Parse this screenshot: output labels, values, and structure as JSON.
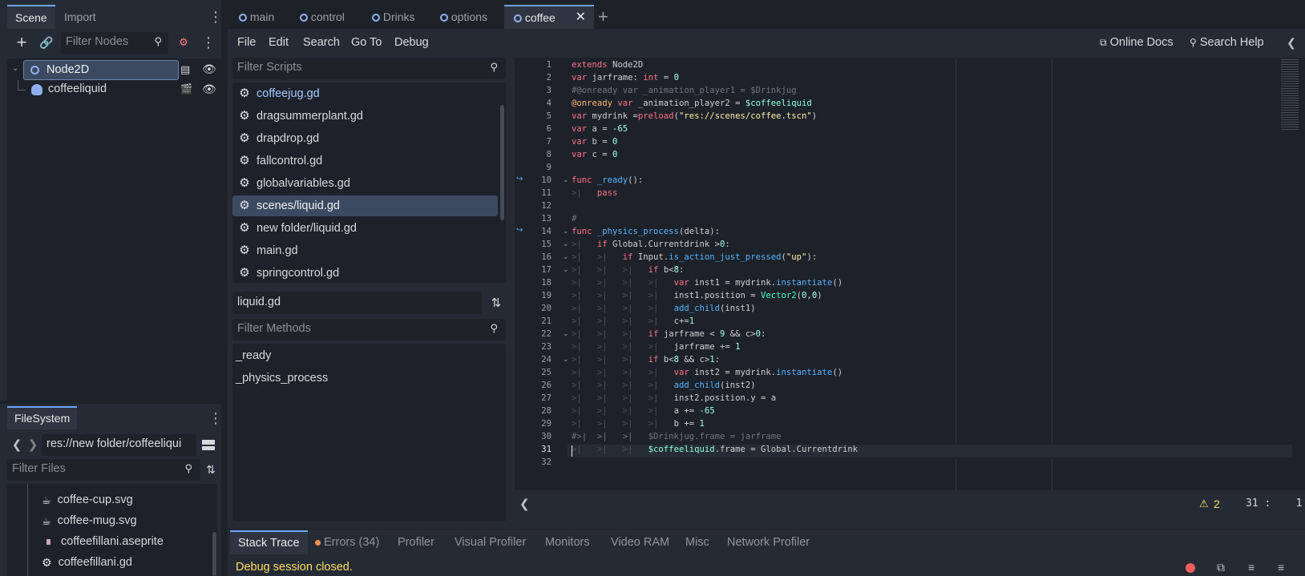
{
  "scene_dock": {
    "tabs": [
      "Scene",
      "Import"
    ],
    "filter_placeholder": "Filter Nodes",
    "tree": [
      {
        "label": "Node2D",
        "icon": "node2d-icon"
      },
      {
        "label": "coffeeliquid",
        "icon": "animated-sprite-icon"
      }
    ]
  },
  "filesystem": {
    "tab": "FileSystem",
    "path": "res://new folder/coffeeliqui",
    "filter_placeholder": "Filter Files",
    "items": [
      {
        "label": "coffee-cup.svg",
        "icon": "cup-icon"
      },
      {
        "label": "coffee-mug.svg",
        "icon": "mug-icon"
      },
      {
        "label": "coffeefillani.aseprite",
        "icon": "file-icon"
      },
      {
        "label": "coffeefillani.gd",
        "icon": "gear-icon"
      }
    ]
  },
  "main_tabs": [
    {
      "label": "main",
      "active": false
    },
    {
      "label": "control",
      "active": false
    },
    {
      "label": "Drinks",
      "active": false
    },
    {
      "label": "options",
      "active": false
    },
    {
      "label": "coffee",
      "active": true
    }
  ],
  "menu": {
    "items": [
      "File",
      "Edit",
      "Search",
      "Go To",
      "Debug"
    ],
    "online_docs": "Online Docs",
    "search_help": "Search Help"
  },
  "scripts": {
    "filter_placeholder": "Filter Scripts",
    "items": [
      {
        "label": "coffeejug.gd",
        "state": "highlight"
      },
      {
        "label": "dragsummerplant.gd",
        "state": "normal"
      },
      {
        "label": "drapdrop.gd",
        "state": "normal"
      },
      {
        "label": "fallcontrol.gd",
        "state": "normal"
      },
      {
        "label": "globalvariables.gd",
        "state": "normal"
      },
      {
        "label": "scenes/liquid.gd",
        "state": "selected"
      },
      {
        "label": "new folder/liquid.gd",
        "state": "normal"
      },
      {
        "label": "main.gd",
        "state": "normal"
      },
      {
        "label": "springcontrol.gd",
        "state": "normal"
      }
    ],
    "current_file": "liquid.gd",
    "methods_placeholder": "Filter Methods",
    "methods": [
      "_ready",
      "_physics_process"
    ]
  },
  "code": {
    "lines": [
      [
        [
          "kw",
          "extends "
        ],
        [
          "plain",
          "Node2D"
        ]
      ],
      [
        [
          "kw",
          "var "
        ],
        [
          "plain",
          "jarframe: "
        ],
        [
          "kw",
          "int"
        ],
        [
          "plain",
          " = "
        ],
        [
          "num",
          "0"
        ]
      ],
      [
        [
          "cmt",
          "#@onready var _animation_player1 = $Drinkjug"
        ]
      ],
      [
        [
          "ann",
          "@onready "
        ],
        [
          "kw",
          "var "
        ],
        [
          "plain",
          "_animation_player2 = "
        ],
        [
          "node",
          "$coffeeliquid"
        ]
      ],
      [
        [
          "kw",
          "var "
        ],
        [
          "plain",
          "mydrink ="
        ],
        [
          "kw",
          "preload"
        ],
        [
          "plain",
          "("
        ],
        [
          "str",
          "\"res://scenes/coffee.tscn\""
        ],
        [
          "plain",
          ")"
        ]
      ],
      [
        [
          "kw",
          "var "
        ],
        [
          "plain",
          "a = "
        ],
        [
          "num",
          "-65"
        ]
      ],
      [
        [
          "kw",
          "var "
        ],
        [
          "plain",
          "b = "
        ],
        [
          "num",
          "0"
        ]
      ],
      [
        [
          "kw",
          "var "
        ],
        [
          "plain",
          "c = "
        ],
        [
          "num",
          "0"
        ]
      ],
      [],
      [
        [
          "kw",
          "func "
        ],
        [
          "fn",
          "_ready"
        ],
        [
          "plain",
          "():"
        ]
      ],
      [
        [
          "guide",
          ">|   "
        ],
        [
          "kw",
          "pass"
        ]
      ],
      [],
      [
        [
          "cmt",
          "#"
        ]
      ],
      [
        [
          "kw",
          "func "
        ],
        [
          "fn",
          "_physics_process"
        ],
        [
          "plain",
          "(delta):"
        ]
      ],
      [
        [
          "guide",
          ">|   "
        ],
        [
          "kw",
          "if "
        ],
        [
          "plain",
          "Global.Currentdrink >"
        ],
        [
          "num",
          "0"
        ],
        [
          "plain",
          ":"
        ]
      ],
      [
        [
          "guide",
          ">|   >|   "
        ],
        [
          "kw",
          "if "
        ],
        [
          "plain",
          "Input."
        ],
        [
          "fn",
          "is_action_just_pressed"
        ],
        [
          "plain",
          "("
        ],
        [
          "str",
          "\"up\""
        ],
        [
          "plain",
          "):"
        ]
      ],
      [
        [
          "guide",
          ">|   >|   >|   "
        ],
        [
          "kw",
          "if "
        ],
        [
          "plain",
          "b<"
        ],
        [
          "num",
          "8"
        ],
        [
          "plain",
          ":"
        ]
      ],
      [
        [
          "guide",
          ">|   >|   >|   >|   "
        ],
        [
          "kw",
          "var "
        ],
        [
          "plain",
          "inst1 = mydrink."
        ],
        [
          "fn",
          "instantiate"
        ],
        [
          "plain",
          "()"
        ]
      ],
      [
        [
          "guide",
          ">|   >|   >|   >|   "
        ],
        [
          "plain",
          "inst1.position = "
        ],
        [
          "ty",
          "Vector2"
        ],
        [
          "plain",
          "("
        ],
        [
          "num",
          "0"
        ],
        [
          "plain",
          ","
        ],
        [
          "num",
          "0"
        ],
        [
          "plain",
          ")"
        ]
      ],
      [
        [
          "guide",
          ">|   >|   >|   >|   "
        ],
        [
          "fn",
          "add_child"
        ],
        [
          "plain",
          "(inst1)"
        ]
      ],
      [
        [
          "guide",
          ">|   >|   >|   >|   "
        ],
        [
          "plain",
          "c+="
        ],
        [
          "num",
          "1"
        ]
      ],
      [
        [
          "guide",
          ">|   >|   >|   "
        ],
        [
          "kw",
          "if "
        ],
        [
          "plain",
          "jarframe < "
        ],
        [
          "num",
          "9"
        ],
        [
          "plain",
          " && c>"
        ],
        [
          "num",
          "0"
        ],
        [
          "plain",
          ":"
        ]
      ],
      [
        [
          "guide",
          ">|   >|   >|   >|   "
        ],
        [
          "plain",
          "jarframe += "
        ],
        [
          "num",
          "1"
        ]
      ],
      [
        [
          "guide",
          ">|   >|   >|   "
        ],
        [
          "kw",
          "if "
        ],
        [
          "plain",
          "b<"
        ],
        [
          "num",
          "8"
        ],
        [
          "plain",
          " && c>"
        ],
        [
          "num",
          "1"
        ],
        [
          "plain",
          ":"
        ]
      ],
      [
        [
          "guide",
          ">|   >|   >|   >|   "
        ],
        [
          "kw",
          "var "
        ],
        [
          "plain",
          "inst2 = mydrink."
        ],
        [
          "fn",
          "instantiate"
        ],
        [
          "plain",
          "()"
        ]
      ],
      [
        [
          "guide",
          ">|   >|   >|   >|   "
        ],
        [
          "fn",
          "add_child"
        ],
        [
          "plain",
          "(inst2)"
        ]
      ],
      [
        [
          "guide",
          ">|   >|   >|   >|   "
        ],
        [
          "plain",
          "inst2.position.y = a"
        ]
      ],
      [
        [
          "guide",
          ">|   >|   >|   >|   "
        ],
        [
          "plain",
          "a += "
        ],
        [
          "num",
          "-65"
        ]
      ],
      [
        [
          "guide",
          ">|   >|   >|   >|   "
        ],
        [
          "plain",
          "b += "
        ],
        [
          "num",
          "1"
        ]
      ],
      [
        [
          "cmt",
          "#>|  >|   >|   $Drinkjug.frame = jarframe"
        ]
      ],
      [
        [
          "guide",
          ">|   >|   >|   "
        ],
        [
          "node",
          "$coffeeliquid"
        ],
        [
          "plain",
          ".frame = Global.Currentdrink"
        ]
      ],
      []
    ],
    "warnings": "2",
    "cursor": "31 :    1"
  },
  "bottom": {
    "tabs": [
      "Stack Trace",
      "Errors (34)",
      "Profiler",
      "Visual Profiler",
      "Monitors",
      "Video RAM",
      "Misc",
      "Network Profiler"
    ],
    "status": "Debug session closed."
  }
}
